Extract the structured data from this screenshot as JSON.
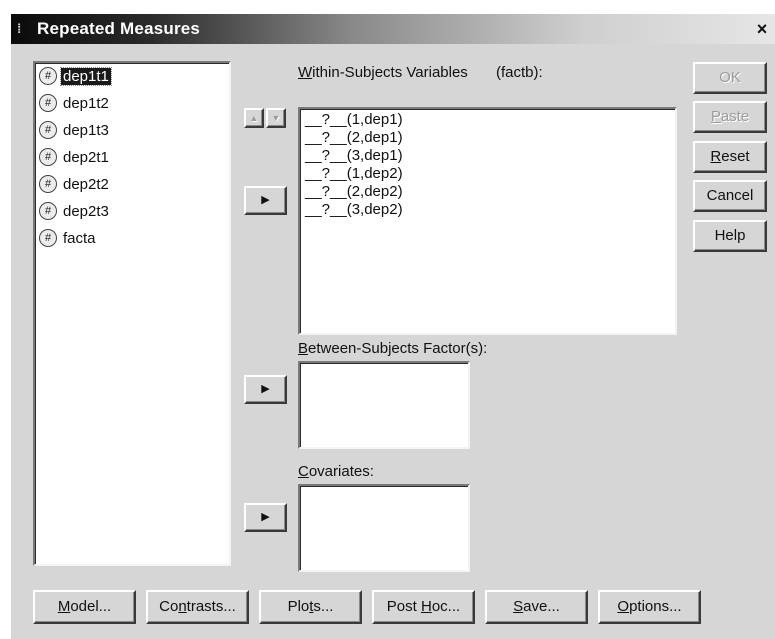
{
  "window": {
    "title": "Repeated Measures",
    "close_label": "×"
  },
  "variables": [
    "dep1t1",
    "dep1t2",
    "dep1t3",
    "dep2t1",
    "dep2t2",
    "dep2t3",
    "facta"
  ],
  "selected_variable": "dep1t1",
  "within_subjects": {
    "label_prefix": "W",
    "label_rest": "ithin-Subjects Variables",
    "factor": "(factb):",
    "items": [
      "__?__(1,dep1)",
      "__?__(2,dep1)",
      "__?__(3,dep1)",
      "__?__(1,dep2)",
      "__?__(2,dep2)",
      "__?__(3,dep2)"
    ]
  },
  "between_subjects": {
    "label_prefix": "B",
    "label_rest": "etween-Subjects Factor(s):"
  },
  "covariates": {
    "label_prefix": "C",
    "label_rest": "ovariates:"
  },
  "side_buttons": {
    "ok": "OK",
    "paste_u": "P",
    "paste_rest": "aste",
    "reset_u": "R",
    "reset_rest": "eset",
    "cancel": "Cancel",
    "help": "Help"
  },
  "bottom_buttons": {
    "model_u": "M",
    "model_rest": "odel...",
    "contrasts_pre": "Co",
    "contrasts_u": "n",
    "contrasts_rest": "trasts...",
    "plots_pre": "Plo",
    "plots_u": "t",
    "plots_rest": "s...",
    "posthoc_pre": "Post ",
    "posthoc_u": "H",
    "posthoc_rest": "oc...",
    "save_u": "S",
    "save_rest": "ave...",
    "options_u": "O",
    "options_rest": "ptions..."
  },
  "icons": {
    "scale_variable": "scale-variable-icon",
    "arrow_right": "▶",
    "arrow_up": "▲",
    "arrow_down": "▼"
  }
}
